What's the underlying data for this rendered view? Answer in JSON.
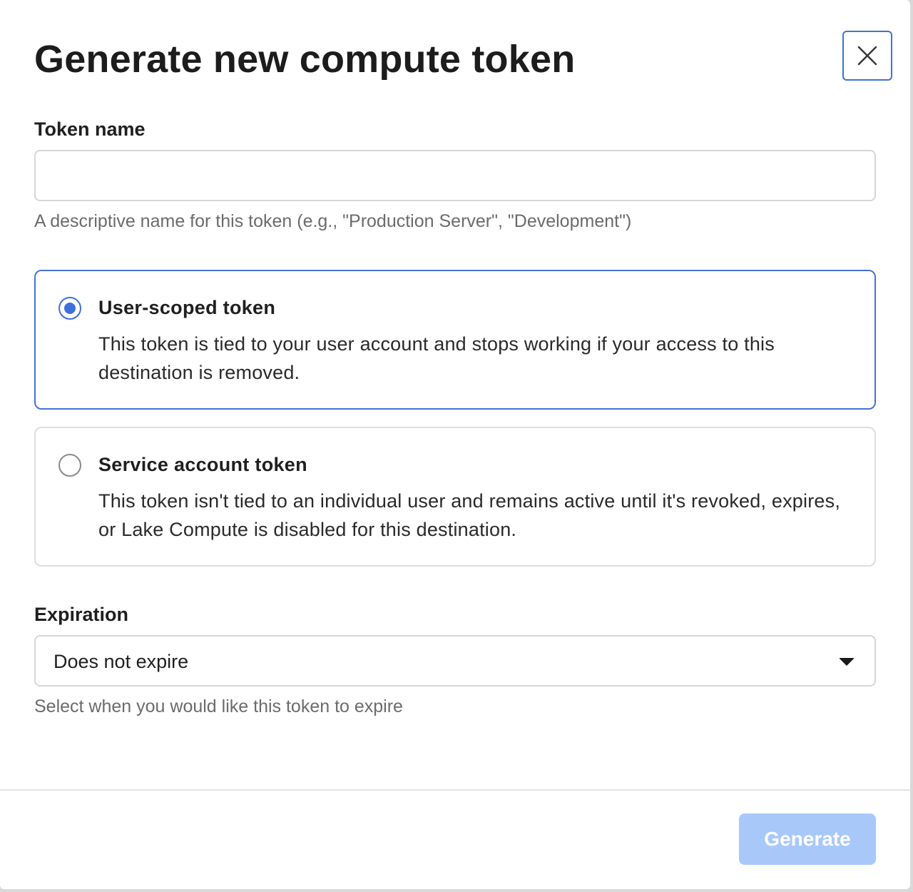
{
  "dialog": {
    "title": "Generate new compute token"
  },
  "token_name": {
    "label": "Token name",
    "value": "",
    "placeholder": "",
    "helper": "A descriptive name for this token (e.g., \"Production Server\", \"Development\")"
  },
  "token_type": {
    "options": [
      {
        "title": "User-scoped token",
        "description": "This token is tied to your user account and stops working if your access to this destination is removed.",
        "selected": true
      },
      {
        "title": "Service account token",
        "description": "This token isn't tied to an individual user and remains active until it's revoked, expires, or Lake Compute is disabled for this destination.",
        "selected": false
      }
    ]
  },
  "expiration": {
    "label": "Expiration",
    "selected_value": "Does not expire",
    "helper": "Select when you would like this token to expire"
  },
  "footer": {
    "generate_label": "Generate"
  },
  "icons": {
    "close": "close-icon",
    "dropdown": "caret-down-icon"
  },
  "colors": {
    "accent": "#3f6fd9",
    "primary_button_disabled": "#a8c8fa",
    "helper_text": "#6b6b6b"
  }
}
